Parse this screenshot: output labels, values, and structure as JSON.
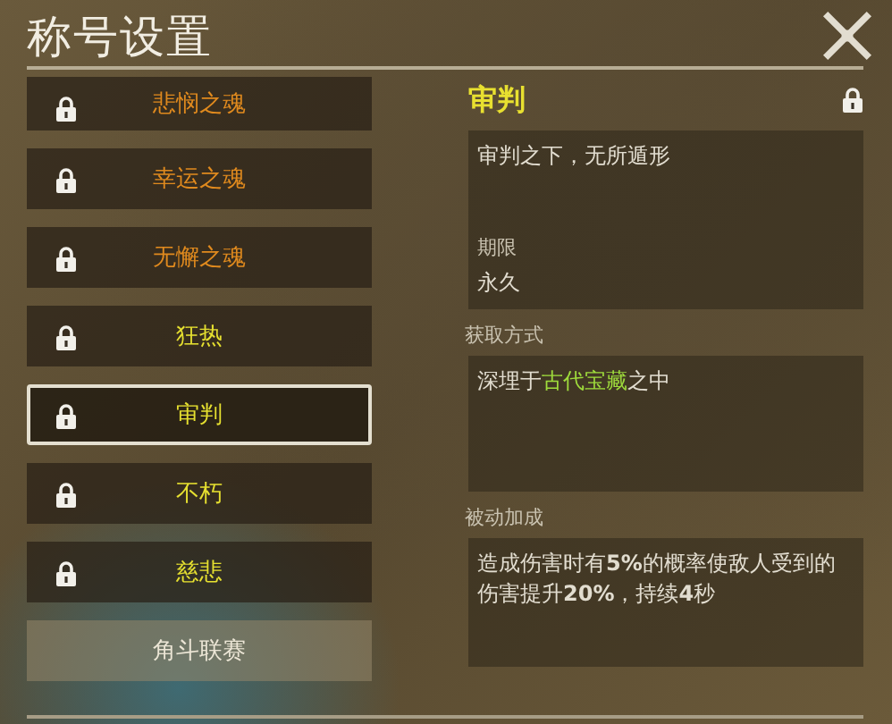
{
  "window": {
    "title": "称号设置"
  },
  "titles": [
    {
      "label": "悲悯之魂",
      "color": "#e08a1e",
      "locked": true,
      "selected": false,
      "kind": "title"
    },
    {
      "label": "幸运之魂",
      "color": "#e08a1e",
      "locked": true,
      "selected": false,
      "kind": "title"
    },
    {
      "label": "无懈之魂",
      "color": "#e08a1e",
      "locked": true,
      "selected": false,
      "kind": "title"
    },
    {
      "label": "狂热",
      "color": "#e6e030",
      "locked": true,
      "selected": false,
      "kind": "title"
    },
    {
      "label": "审判",
      "color": "#e6e030",
      "locked": true,
      "selected": true,
      "kind": "title"
    },
    {
      "label": "不朽",
      "color": "#e6e030",
      "locked": true,
      "selected": false,
      "kind": "title"
    },
    {
      "label": "慈悲",
      "color": "#e6e030",
      "locked": true,
      "selected": false,
      "kind": "title"
    },
    {
      "label": "角斗联赛",
      "selected": false,
      "kind": "category"
    }
  ],
  "detail": {
    "name": "审判",
    "locked": true,
    "description": "审判之下，无所遁形",
    "period_label": "期限",
    "period": "永久",
    "source_label": "获取方式",
    "source": [
      {
        "text": "深埋于",
        "highlight": false
      },
      {
        "text": "古代宝藏",
        "highlight": true
      },
      {
        "text": "之中",
        "highlight": false
      }
    ],
    "bonus_label": "被动加成",
    "bonus": "造成伤害时有**5%**的概率使敌人受到的伤害提升**20%**，持续**4**秒"
  }
}
